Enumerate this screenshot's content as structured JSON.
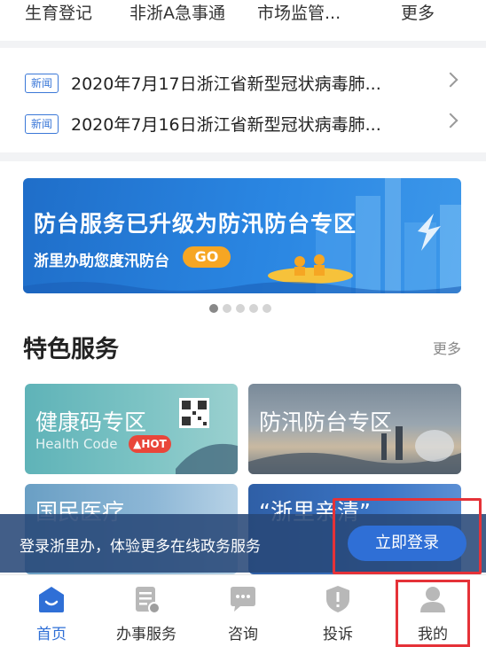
{
  "top_services": [
    "生育登记",
    "非浙A急事通",
    "市场监管...",
    "更多"
  ],
  "news": [
    {
      "tag": "新闻",
      "text": "2020年7月17日浙江省新型冠状病毒肺..."
    },
    {
      "tag": "新闻",
      "text": "2020年7月16日浙江省新型冠状病毒肺..."
    }
  ],
  "banner": {
    "title": "防台服务已升级为防汛防台专区",
    "subtitle": "浙里办助您度汛防台",
    "go_label": "GO",
    "page_count": 5,
    "active_page": 1
  },
  "section": {
    "title": "特色服务",
    "more": "更多"
  },
  "cards": [
    {
      "title": "健康码专区",
      "subtitle": "Health Code",
      "badge": "HOT"
    },
    {
      "title": "防汛防台专区"
    },
    {
      "title": "国民医疗"
    },
    {
      "title": "“浙里亲清”"
    }
  ],
  "login_bar": {
    "text": "登录浙里办，体验更多在线政务服务",
    "button": "立即登录"
  },
  "tabs": [
    {
      "label": "首页",
      "icon": "home-icon",
      "active": true
    },
    {
      "label": "办事服务",
      "icon": "document-icon",
      "active": false
    },
    {
      "label": "咨询",
      "icon": "chat-icon",
      "active": false
    },
    {
      "label": "投诉",
      "icon": "shield-icon",
      "active": false
    },
    {
      "label": "我的",
      "icon": "user-icon",
      "active": false
    }
  ],
  "colors": {
    "accent": "#2f6fd6",
    "highlight": "#e53238",
    "banner": "#2a86e2"
  }
}
